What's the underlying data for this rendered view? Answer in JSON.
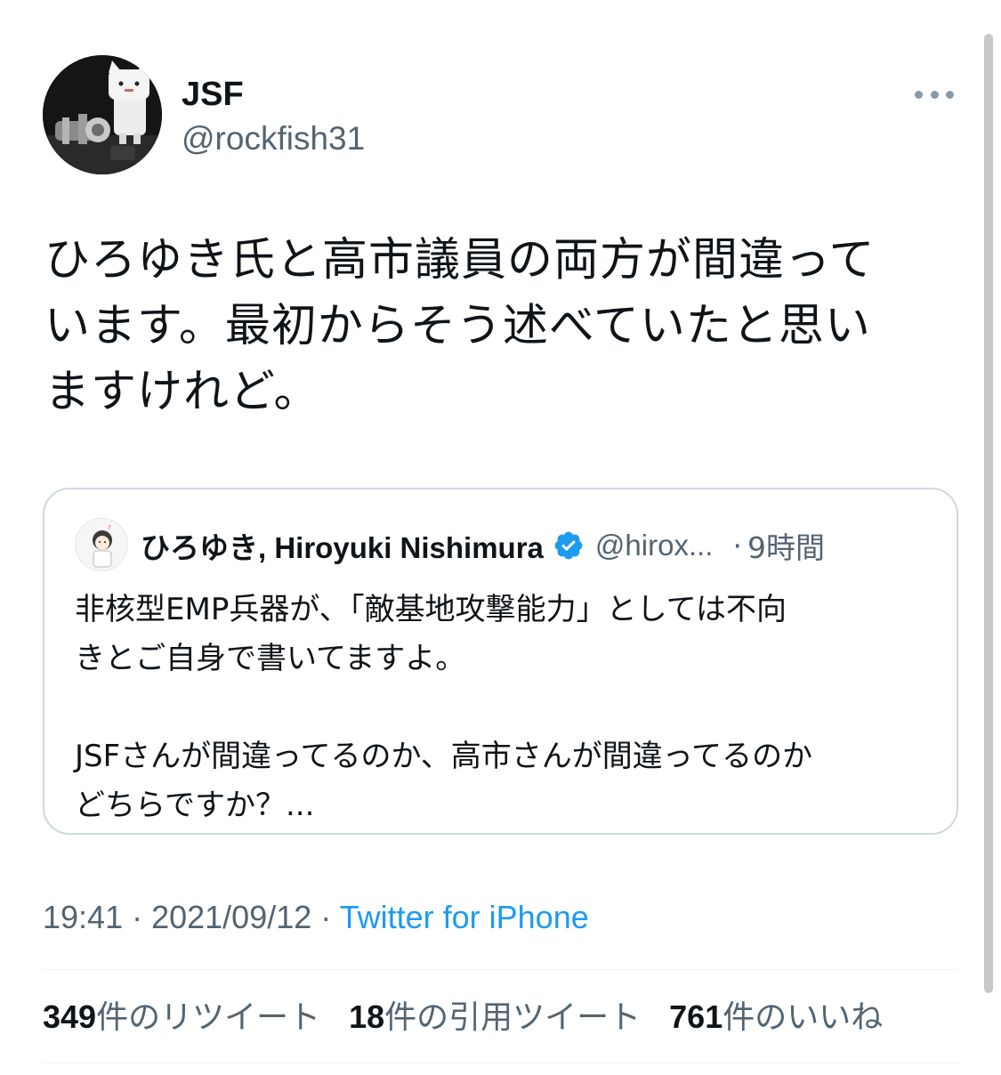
{
  "tweet": {
    "author": {
      "name": "JSF",
      "handle": "@rockfish31"
    },
    "text": "ひろゆき氏と高市議員の両方が間違って\nいます。最初からそう述べていたと思い\nますけれど。",
    "quoted": {
      "name": "ひろゆき, Hiroyuki Nishimura",
      "handle": "@hirox...",
      "separator": "·",
      "time": "9時間",
      "text": "非核型EMP兵器が、「敵基地攻撃能力」としては不向\nきとご自身で書いてますよ。\n\nJSFさんが間違ってるのか、高市さんが間違ってるのか\nどちらですか？..."
    },
    "timestamp": "19:41 · 2021/09/12 · ",
    "source": "Twitter for iPhone",
    "stats": [
      {
        "count": "349",
        "label": "件のリツイート"
      },
      {
        "count": "18",
        "label": "件の引用ツイート"
      },
      {
        "count": "761",
        "label": "件のいいね"
      }
    ]
  },
  "colors": {
    "text": "#0f1419",
    "secondary": "#536471",
    "link": "#1d9bf0",
    "border": "#cfd9de",
    "verified": "#1d9bf0"
  },
  "icons": {
    "more": "more-dots-icon",
    "verified": "verified-badge-icon"
  }
}
